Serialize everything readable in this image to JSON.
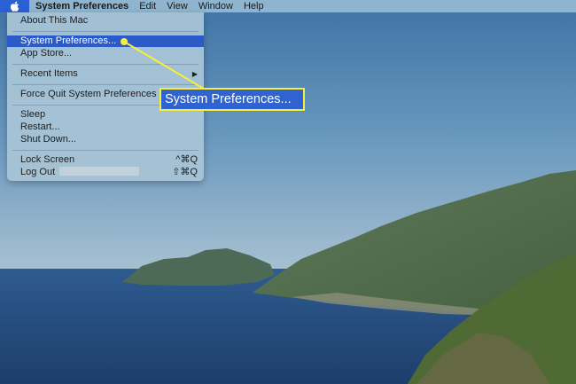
{
  "menubar": {
    "app_name": "System Preferences",
    "items": [
      "Edit",
      "View",
      "Window",
      "Help"
    ]
  },
  "apple_menu": {
    "about": "About This Mac",
    "system_preferences": "System Preferences...",
    "app_store": "App Store...",
    "recent_items": "Recent Items",
    "force_quit": "Force Quit System Preferences",
    "sleep": "Sleep",
    "restart": "Restart...",
    "shut_down": "Shut Down...",
    "lock_screen": "Lock Screen",
    "lock_screen_shortcut": "^⌘Q",
    "log_out": "Log Out",
    "log_out_shortcut": "⇧⌘Q",
    "submenu_arrow": "▶"
  },
  "callout": {
    "label": "System Preferences..."
  },
  "icons": [
    "apple-icon",
    "submenu-arrow-icon"
  ],
  "colors": {
    "highlight": "#2a5bc9",
    "callout_fill": "#2f64d0",
    "callout_border": "#f7ef3b"
  }
}
